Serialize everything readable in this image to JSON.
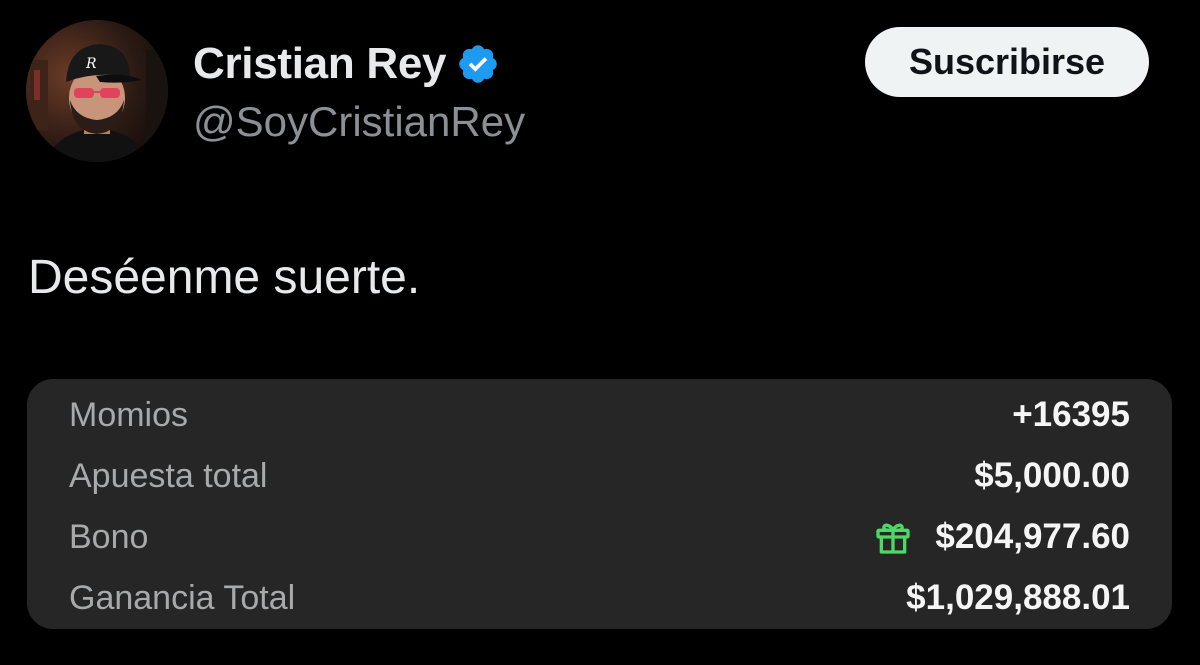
{
  "profile": {
    "display_name": "Cristian Rey",
    "handle": "@SoyCristianRey",
    "verified": true,
    "cap_letter": "R"
  },
  "actions": {
    "subscribe_label": "Suscribirse"
  },
  "tweet": {
    "text": "Deséenme suerte."
  },
  "bet_summary": {
    "rows": [
      {
        "label": "Momios",
        "value": "+16395"
      },
      {
        "label": "Apuesta total",
        "value": "$5,000.00"
      },
      {
        "label": "Bono",
        "value": "$204,977.60",
        "icon": "gift-icon"
      },
      {
        "label": "Ganancia Total",
        "value": "$1,029,888.01"
      }
    ]
  },
  "colors": {
    "background": "#000000",
    "verified_badge": "#1d9bf0",
    "gift_icon": "#4cd964",
    "card_background": "#262626"
  }
}
